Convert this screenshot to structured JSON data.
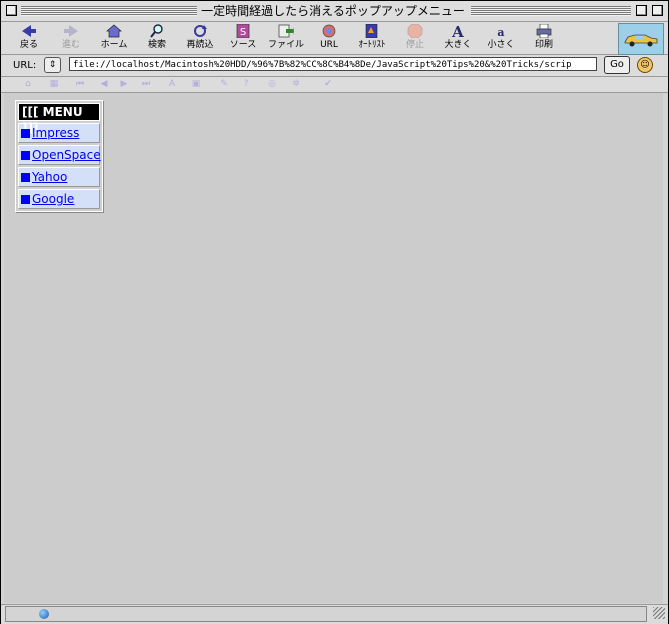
{
  "window": {
    "title": "一定時間経過したら消えるポップアップメニュー"
  },
  "toolbar": {
    "buttons": [
      {
        "label": "戻る",
        "icon": "back-arrow-icon",
        "enabled": true
      },
      {
        "label": "進む",
        "icon": "forward-arrow-icon",
        "enabled": false
      },
      {
        "label": "ホーム",
        "icon": "home-icon",
        "enabled": true
      },
      {
        "label": "検索",
        "icon": "search-icon",
        "enabled": true
      },
      {
        "label": "再読込",
        "icon": "reload-icon",
        "enabled": true
      },
      {
        "label": "ソース",
        "icon": "source-icon",
        "enabled": true
      },
      {
        "label": "ファイル",
        "icon": "file-icon",
        "enabled": true
      },
      {
        "label": "URL",
        "icon": "url-icon",
        "enabled": true
      },
      {
        "label": "ｵｰﾄﾘｽﾄ",
        "icon": "autolist-icon",
        "enabled": true
      },
      {
        "label": "停止",
        "icon": "stop-icon",
        "enabled": false
      },
      {
        "label": "大きく",
        "icon": "font-larger-icon",
        "enabled": true
      },
      {
        "label": "小さく",
        "icon": "font-smaller-icon",
        "enabled": true
      },
      {
        "label": "印刷",
        "icon": "print-icon",
        "enabled": true
      }
    ]
  },
  "urlbar": {
    "label": "URL:",
    "value": "file://localhost/Macintosh%20HDD/%96%7B%82%CC%8C%B4%8De/JavaScript%20Tips%20&%20Tricks/scrip",
    "go_label": "Go"
  },
  "menu": {
    "title": "[[[ MENU ]]]",
    "items": [
      {
        "label": "Impress"
      },
      {
        "label": "OpenSpace"
      },
      {
        "label": "Yahoo"
      },
      {
        "label": "Google"
      }
    ]
  },
  "colors": {
    "link": "#0000ee",
    "menu_item_bg": "#d4e0f7",
    "menu_title_bg": "#000000",
    "content_bg": "#cccccc"
  }
}
